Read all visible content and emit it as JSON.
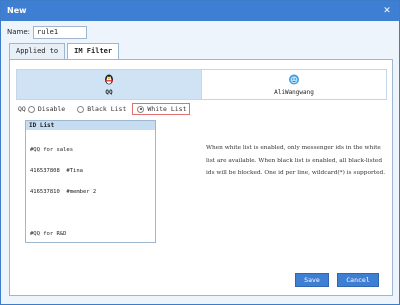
{
  "dialog": {
    "title": "New",
    "close_icon": "close-icon"
  },
  "name_field": {
    "label": "Name:",
    "value": "rule1"
  },
  "tabs": [
    {
      "label": "Applied to",
      "active": false
    },
    {
      "label": "IM Filter",
      "active": true
    }
  ],
  "messengers": [
    {
      "label": "QQ",
      "icon": "qq-penguin-icon",
      "selected": true
    },
    {
      "label": "AliWangwang",
      "icon": "aliwangwang-icon",
      "selected": false
    }
  ],
  "mode": {
    "prefix": "QQ",
    "options": [
      {
        "label": "Disable",
        "checked": false
      },
      {
        "label": "Black List",
        "checked": false
      },
      {
        "label": "White List",
        "checked": true
      }
    ]
  },
  "id_list": {
    "header": "ID List",
    "lines": [
      "#QQ for sales",
      "416537808  #Tina",
      "416537810  #member 2",
      "",
      "#QQ for R&D"
    ]
  },
  "help_text": "When white list is enabled, only messenger ids in the white list are available. When black list is enabled, all black-listed ids will be blocked. One id per line, wildcard(*) is supported.",
  "buttons": {
    "save": "Save",
    "cancel": "Cancel"
  },
  "colors": {
    "titlebar": "#3e7fd3",
    "tab_selected": "#cfe3f5",
    "white_list_highlight": "#e07070"
  }
}
